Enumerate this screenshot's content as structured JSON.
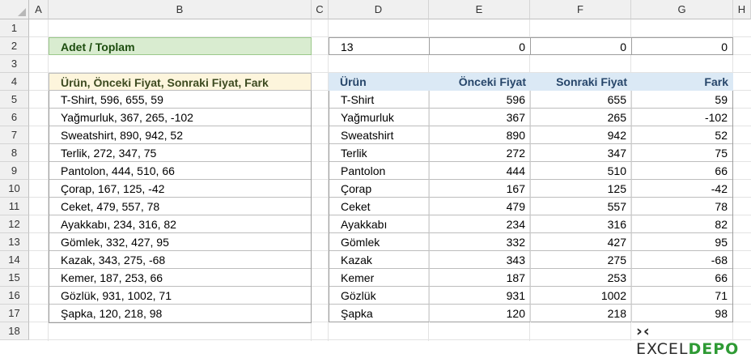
{
  "columns": [
    "A",
    "B",
    "C",
    "D",
    "E",
    "F",
    "G",
    "H"
  ],
  "rows": [
    "1",
    "2",
    "3",
    "4",
    "5",
    "6",
    "7",
    "8",
    "9",
    "10",
    "11",
    "12",
    "13",
    "14",
    "15",
    "16",
    "17",
    "18"
  ],
  "summary": {
    "label": "Adet / Toplam",
    "count": "13",
    "total_e": "0",
    "total_f": "0",
    "total_g": "0"
  },
  "source": {
    "header": "Ürün, Önceki Fiyat, Sonraki Fiyat, Fark",
    "lines": [
      "T-Shirt, 596, 655, 59",
      "Yağmurluk, 367, 265, -102",
      "Sweatshirt, 890, 942, 52",
      "Terlik, 272, 347, 75",
      "Pantolon, 444, 510, 66",
      "Çorap, 167, 125, -42",
      "Ceket, 479, 557, 78",
      "Ayakkabı, 234, 316, 82",
      "Gömlek, 332, 427, 95",
      "Kazak, 343, 275, -68",
      "Kemer, 187, 253, 66",
      "Gözlük, 931, 1002, 71",
      "Şapka, 120, 218, 98"
    ]
  },
  "table": {
    "headers": [
      "Ürün",
      "Önceki Fiyat",
      "Sonraki Fiyat",
      "Fark"
    ],
    "rows": [
      [
        "T-Shirt",
        "596",
        "655",
        "59"
      ],
      [
        "Yağmurluk",
        "367",
        "265",
        "-102"
      ],
      [
        "Sweatshirt",
        "890",
        "942",
        "52"
      ],
      [
        "Terlik",
        "272",
        "347",
        "75"
      ],
      [
        "Pantolon",
        "444",
        "510",
        "66"
      ],
      [
        "Çorap",
        "167",
        "125",
        "-42"
      ],
      [
        "Ceket",
        "479",
        "557",
        "78"
      ],
      [
        "Ayakkabı",
        "234",
        "316",
        "82"
      ],
      [
        "Gömlek",
        "332",
        "427",
        "95"
      ],
      [
        "Kazak",
        "343",
        "275",
        "-68"
      ],
      [
        "Kemer",
        "187",
        "253",
        "66"
      ],
      [
        "Gözlük",
        "931",
        "1002",
        "71"
      ],
      [
        "Şapka",
        "120",
        "218",
        "98"
      ]
    ]
  },
  "logo": {
    "text_a": "EXCEL",
    "text_b": "DEPO"
  }
}
